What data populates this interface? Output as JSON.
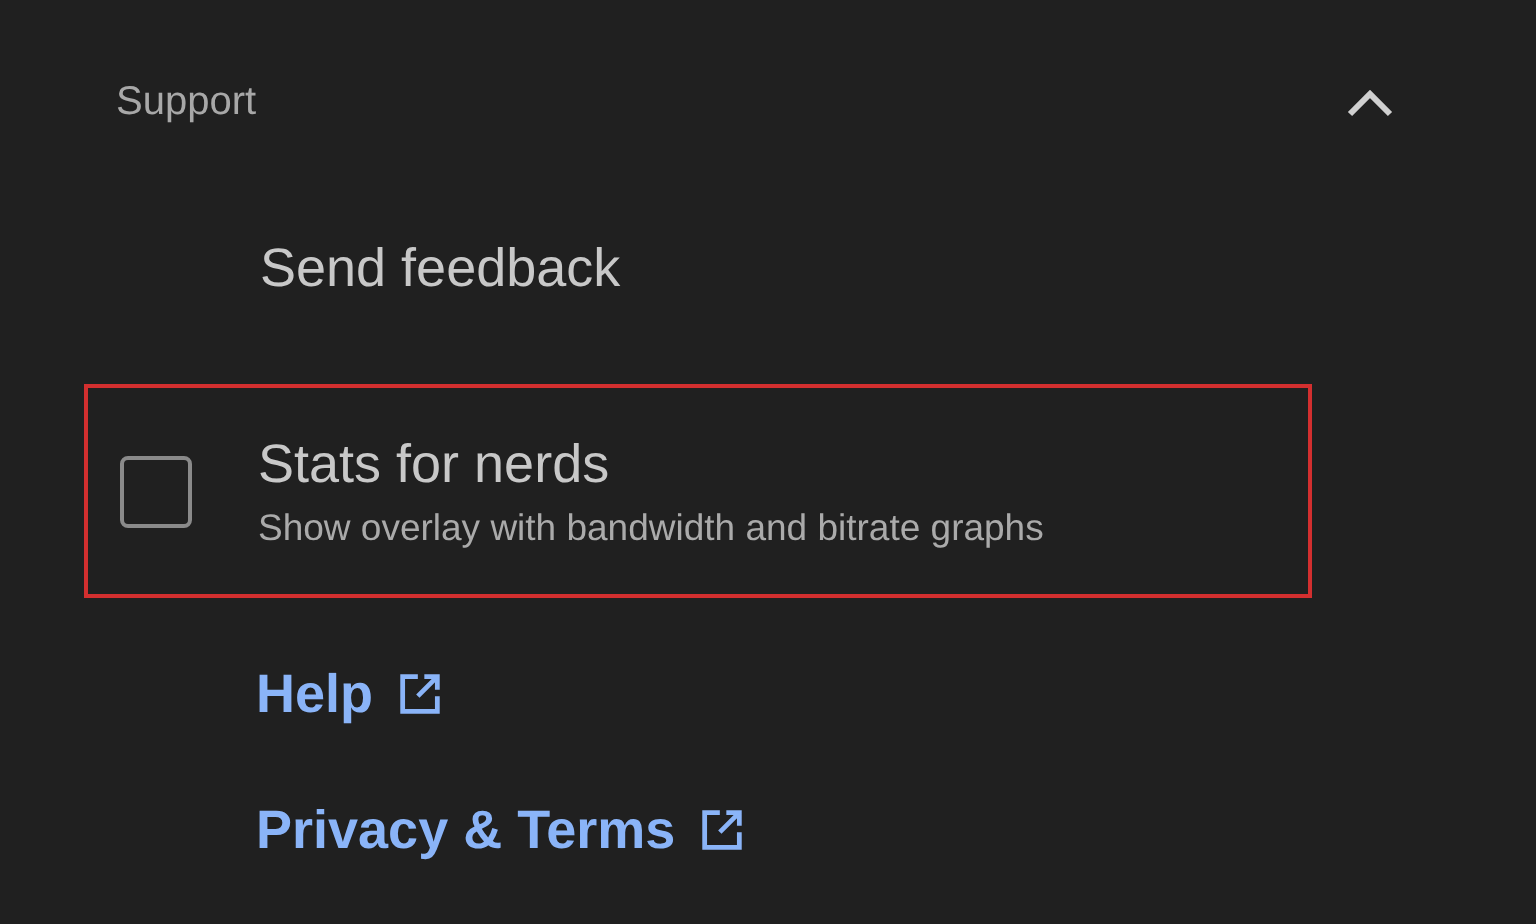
{
  "section": {
    "title": "Support",
    "expanded": true
  },
  "items": [
    {
      "kind": "action",
      "label": "Send feedback"
    },
    {
      "kind": "checkbox",
      "label": "Stats for nerds",
      "description": "Show overlay with bandwidth and bitrate graphs",
      "checked": false,
      "highlighted": true
    },
    {
      "kind": "external_link",
      "label": "Help"
    },
    {
      "kind": "external_link",
      "label": "Privacy & Terms"
    }
  ]
}
